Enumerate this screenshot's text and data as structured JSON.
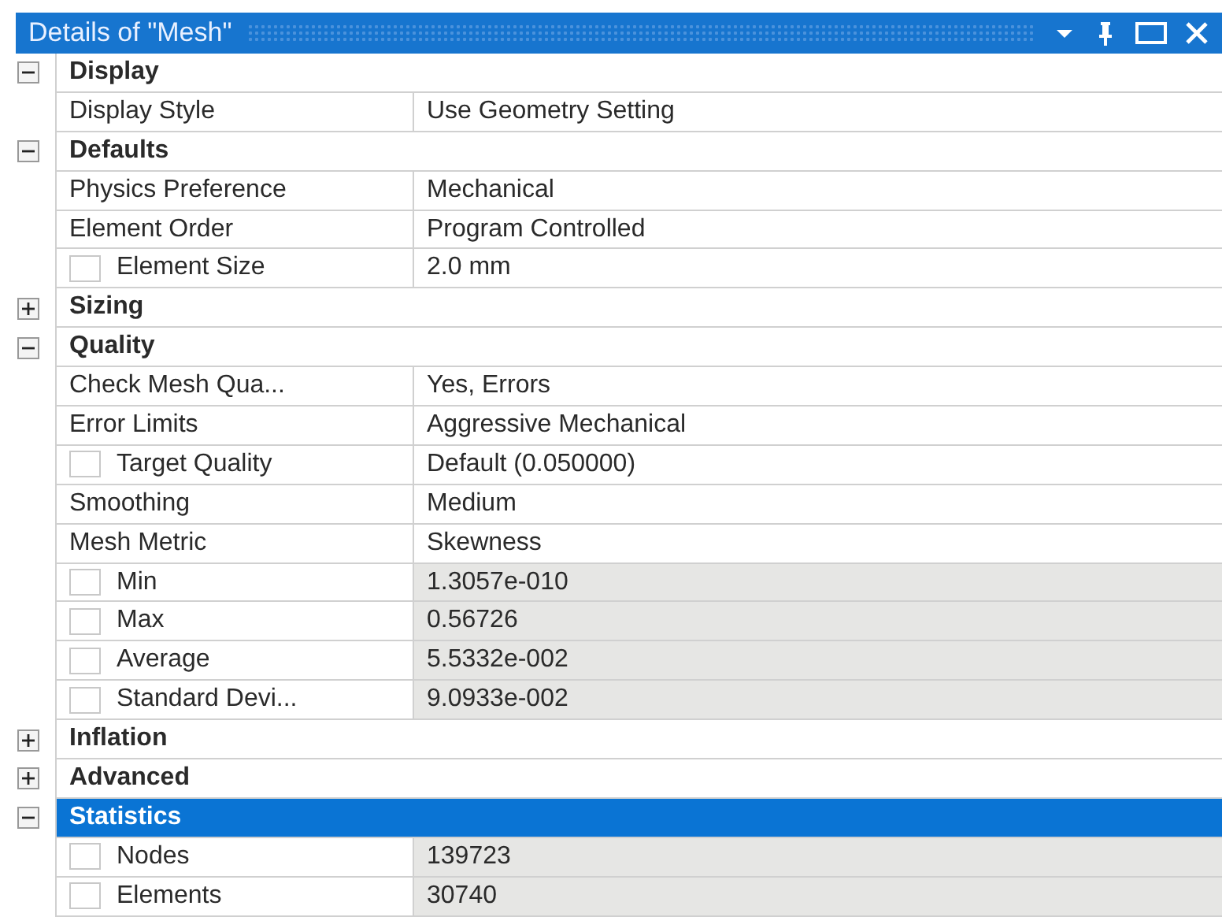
{
  "panel": {
    "title": "Details of \"Mesh\""
  },
  "sections": [
    {
      "name": "Display",
      "expanded": true,
      "selected": false,
      "rows": [
        {
          "kind": "plain",
          "label": "Display Style",
          "value": "Use Geometry Setting",
          "readonly": false
        }
      ]
    },
    {
      "name": "Defaults",
      "expanded": true,
      "selected": false,
      "rows": [
        {
          "kind": "plain",
          "label": "Physics Preference",
          "value": "Mechanical",
          "readonly": false
        },
        {
          "kind": "plain",
          "label": "Element Order",
          "value": "Program Controlled",
          "readonly": false
        },
        {
          "kind": "param",
          "label": "Element Size",
          "value": "2.0 mm",
          "readonly": false,
          "checked": false
        }
      ]
    },
    {
      "name": "Sizing",
      "expanded": false,
      "selected": false
    },
    {
      "name": "Quality",
      "expanded": true,
      "selected": false,
      "rows": [
        {
          "kind": "plain",
          "label": "Check Mesh Qua...",
          "value": "Yes, Errors",
          "readonly": false
        },
        {
          "kind": "plain",
          "label": "Error Limits",
          "value": "Aggressive Mechanical",
          "readonly": false
        },
        {
          "kind": "param",
          "label": "Target Quality",
          "value": "Default (0.050000)",
          "readonly": false,
          "checked": false
        },
        {
          "kind": "plain",
          "label": "Smoothing",
          "value": "Medium",
          "readonly": false
        },
        {
          "kind": "plain",
          "label": "Mesh Metric",
          "value": "Skewness",
          "readonly": false
        },
        {
          "kind": "param",
          "label": "Min",
          "value": "1.3057e-010",
          "readonly": true,
          "checked": false
        },
        {
          "kind": "param",
          "label": "Max",
          "value": "0.56726",
          "readonly": true,
          "checked": false
        },
        {
          "kind": "param",
          "label": "Average",
          "value": "5.5332e-002",
          "readonly": true,
          "checked": false
        },
        {
          "kind": "param",
          "label": "Standard Devi...",
          "value": "9.0933e-002",
          "readonly": true,
          "checked": false
        }
      ]
    },
    {
      "name": "Inflation",
      "expanded": false,
      "selected": false
    },
    {
      "name": "Advanced",
      "expanded": false,
      "selected": false
    },
    {
      "name": "Statistics",
      "expanded": true,
      "selected": true,
      "rows": [
        {
          "kind": "param",
          "label": "Nodes",
          "value": "139723",
          "readonly": true,
          "checked": false
        },
        {
          "kind": "param",
          "label": "Elements",
          "value": "30740",
          "readonly": true,
          "checked": false
        }
      ]
    }
  ]
}
